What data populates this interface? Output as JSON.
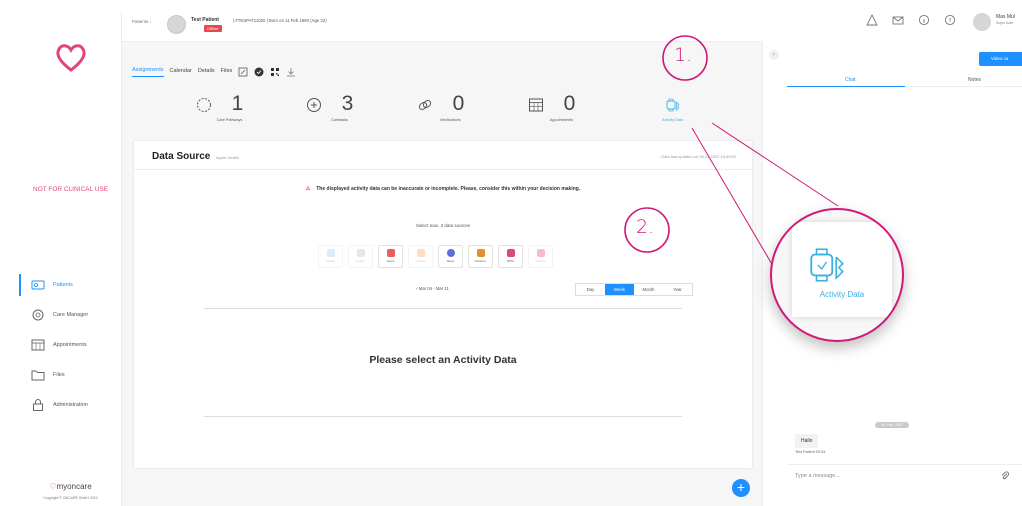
{
  "sidebar": {
    "not_clinical": "NOT FOR CLINICAL USE",
    "items": [
      {
        "label": "Patients",
        "icon": "patients-icon",
        "active": true
      },
      {
        "label": "Care Manager",
        "icon": "care-manager-icon",
        "active": false
      },
      {
        "label": "Appointments",
        "icon": "appointments-icon",
        "active": false
      },
      {
        "label": "Files",
        "icon": "folder-icon",
        "active": false
      },
      {
        "label": "Administration",
        "icon": "lock-icon",
        "active": false
      }
    ],
    "brand": "myoncare",
    "copyright": "Copyright © ONCARE GmbH 2022"
  },
  "header": {
    "breadcrumb": "Patients  ›",
    "patient_name": "Test Patient",
    "patient_meta": "| #TESPAT11020 | Born on 11 Feb 1990 (Age 32)",
    "status": "Offline",
    "user_name": "Max Mül",
    "user_role": "Super Adm"
  },
  "tabs": {
    "assignments": "Assignments",
    "calendar": "Calendar",
    "details": "Details",
    "files": "Files"
  },
  "stats": [
    {
      "value": "1",
      "label": "Care Pathways",
      "icon": "care-pathway-icon"
    },
    {
      "value": "3",
      "label": "Caretasks",
      "icon": "caretask-icon"
    },
    {
      "value": "0",
      "label": "Medications",
      "icon": "pill-icon"
    },
    {
      "value": "0",
      "label": "Appointments",
      "icon": "calendar-grid-icon"
    },
    {
      "value": "",
      "label": "Activity Data",
      "icon": "smartwatch-bluetooth-icon"
    }
  ],
  "card": {
    "title": "Data Source",
    "subtitle": "Apple Health",
    "updated": "Data last updated on 28.03.2022 15:49:52",
    "warning": "The displayed activity data can be inaccurate or incomplete. Please, consider this within your decision making.",
    "select_hint": "Select max. 2 data sources",
    "sources": [
      {
        "label": "Weight",
        "enabled": false,
        "color": "#a9c7e8"
      },
      {
        "label": "Height",
        "enabled": false,
        "color": "#b8b8b8"
      },
      {
        "label": "Steps",
        "enabled": true,
        "color": "#e85d5d"
      },
      {
        "label": "Calories",
        "enabled": false,
        "color": "#f0a15a"
      },
      {
        "label": "Sleep",
        "enabled": true,
        "color": "#5b6fd6"
      },
      {
        "label": "Distance",
        "enabled": true,
        "color": "#e0902e"
      },
      {
        "label": "BPM",
        "enabled": true,
        "color": "#e0457b"
      },
      {
        "label": "Glucose",
        "enabled": false,
        "color": "#e0457b"
      }
    ],
    "range": "‹   Mar 04 - Mar 11",
    "periods": [
      "Day",
      "Week",
      "Month",
      "Year"
    ],
    "active_period": "Week",
    "empty": "Please select an Activity Data"
  },
  "right_panel": {
    "video_call": "Video ca",
    "tab_chat": "Chat",
    "tab_notes": "Notes",
    "date_chip": "15. Feb. 2022",
    "message": "Hallo",
    "sender": "Test Patient 09:34",
    "compose_placeholder": "Type a message..."
  },
  "annotations": {
    "step1": "1.",
    "step2": "2.",
    "zoom_label": "Activity Data"
  },
  "colors": {
    "accent": "#1e90ff",
    "brand_pink": "#e0457b",
    "annotation": "#d0197a",
    "activity": "#3ab0e2"
  }
}
